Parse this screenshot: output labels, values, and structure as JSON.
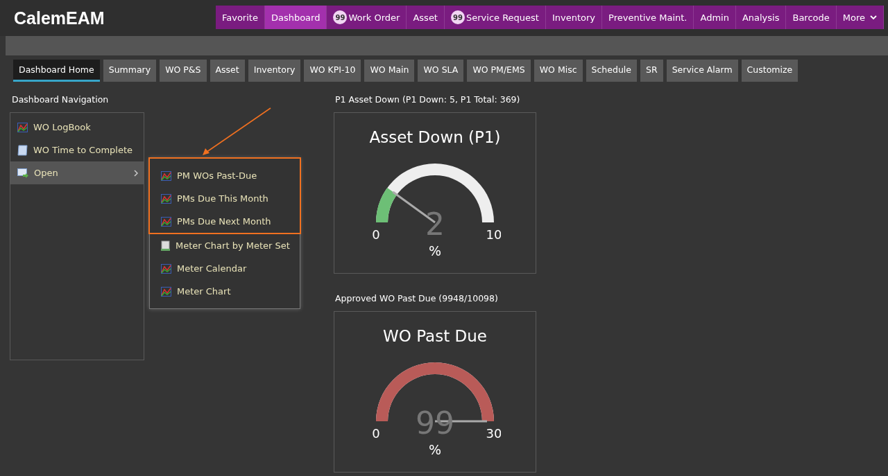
{
  "app": {
    "logo": "CalemEAM"
  },
  "top_nav": [
    {
      "label": "Favorite",
      "selected": false
    },
    {
      "label": "Dashboard",
      "selected": true
    },
    {
      "label": "Work Order",
      "selected": false,
      "badge": "99"
    },
    {
      "label": "Asset",
      "selected": false
    },
    {
      "label": "Service Request",
      "selected": false,
      "badge": "99"
    },
    {
      "label": "Inventory",
      "selected": false
    },
    {
      "label": "Preventive Maint.",
      "selected": false
    },
    {
      "label": "Admin",
      "selected": false
    },
    {
      "label": "Analysis",
      "selected": false
    },
    {
      "label": "Barcode",
      "selected": false
    },
    {
      "label": "More",
      "selected": false,
      "dropdown": true
    }
  ],
  "tabs": [
    {
      "label": "Dashboard Home",
      "selected": true
    },
    {
      "label": "Summary",
      "selected": false
    },
    {
      "label": "WO P&S",
      "selected": false
    },
    {
      "label": "Asset",
      "selected": false
    },
    {
      "label": "Inventory",
      "selected": false
    },
    {
      "label": "WO KPI-10",
      "selected": false
    },
    {
      "label": "WO Main",
      "selected": false
    },
    {
      "label": "WO SLA",
      "selected": false
    },
    {
      "label": "WO PM/EMS",
      "selected": false
    },
    {
      "label": "WO Misc",
      "selected": false
    },
    {
      "label": "Schedule",
      "selected": false
    },
    {
      "label": "SR",
      "selected": false
    },
    {
      "label": "Service Alarm",
      "selected": false
    },
    {
      "label": "Customize",
      "selected": false
    }
  ],
  "navigation": {
    "title": "Dashboard Navigation",
    "items": [
      {
        "label": "WO LogBook",
        "kind": "chart",
        "expanded": false
      },
      {
        "label": "WO Time to Complete",
        "kind": "report",
        "expanded": false
      },
      {
        "label": "Open",
        "kind": "folder",
        "expanded": true,
        "children": [
          {
            "label": "PM WOs Past-Due",
            "kind": "chart",
            "highlighted": true
          },
          {
            "label": "PMs Due This Month",
            "kind": "chart",
            "highlighted": true
          },
          {
            "label": "PMs Due Next Month",
            "kind": "chart",
            "highlighted": true
          },
          {
            "label": "Meter Chart by Meter Set",
            "kind": "meter",
            "highlighted": false
          },
          {
            "label": "Meter Calendar",
            "kind": "chart",
            "highlighted": false
          },
          {
            "label": "Meter Chart",
            "kind": "chart",
            "highlighted": false
          }
        ]
      }
    ]
  },
  "gauges": [
    {
      "title": "P1 Asset Down (P1 Down: 5, P1 Total: 369)",
      "heading": "Asset Down (P1)",
      "value": "2",
      "min": "0",
      "max": "10",
      "unit": "%",
      "level": 0.2,
      "color": "#6dbf76"
    },
    {
      "title": "Approved WO Past Due (9948/10098)",
      "heading": "WO Past Due",
      "value": "99",
      "min": "0",
      "max": "30",
      "unit": "%",
      "level": 1,
      "color": "#b95b58"
    }
  ]
}
